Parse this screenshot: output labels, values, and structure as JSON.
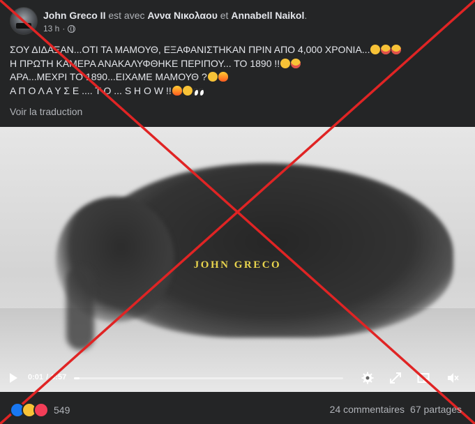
{
  "post": {
    "author": "John Greco II",
    "with_word": "est avec",
    "tagged_1": "Αννα Νικολαου",
    "and_word": "et",
    "tagged_2": "Annabell Naikol",
    "period": ".",
    "time": "13 h",
    "time_sep": "·",
    "privacy_icon": "globe-icon",
    "lines": [
      "ΣΟΥ ΔΙΔΑΞΑΝ...ΟΤΙ ΤΑ ΜΑΜΟΥΘ, ΕΞΑΦΑΝΙΣΤΗΚΑΝ ΠΡΙΝ ΑΠΟ 4,000 ΧΡΟΝΙΑ...",
      "Η ΠΡΩΤΗ ΚΑΜΕΡΑ ΑΝΑΚΑΛΥΦΘΗΚΕ ΠΕΡΙΠΟΥ... ΤΟ 1890 !!",
      "ΑΡΑ...ΜΕΧΡΙ ΤΟ 1890...ΕΙΧΑΜΕ ΜΑΜΟΥΘ ?",
      "Α Π Ο Λ Α Υ Σ Ε .... Τ Ο ... S H O W !!"
    ],
    "translate": "Voir la traduction"
  },
  "video": {
    "watermark": "JOHN GRECO",
    "current_time": "0:01",
    "separator": "/",
    "duration": "0:57",
    "progress": 0.02,
    "icons": [
      "play-icon",
      "settings-icon",
      "expand-icon",
      "pip-icon",
      "volume-icon"
    ]
  },
  "overlay": {
    "type": "red-x-cross",
    "color": "#e02424"
  },
  "footer": {
    "reactions": [
      "like-icon",
      "wow-icon",
      "love-icon"
    ],
    "reaction_count": "549",
    "comments": "24 commentaires",
    "shares": "67 partages"
  },
  "colors": {
    "background": "#242526",
    "text": "#e4e6eb",
    "secondary": "#b0b3b8",
    "watermark": "#e8d44d"
  }
}
